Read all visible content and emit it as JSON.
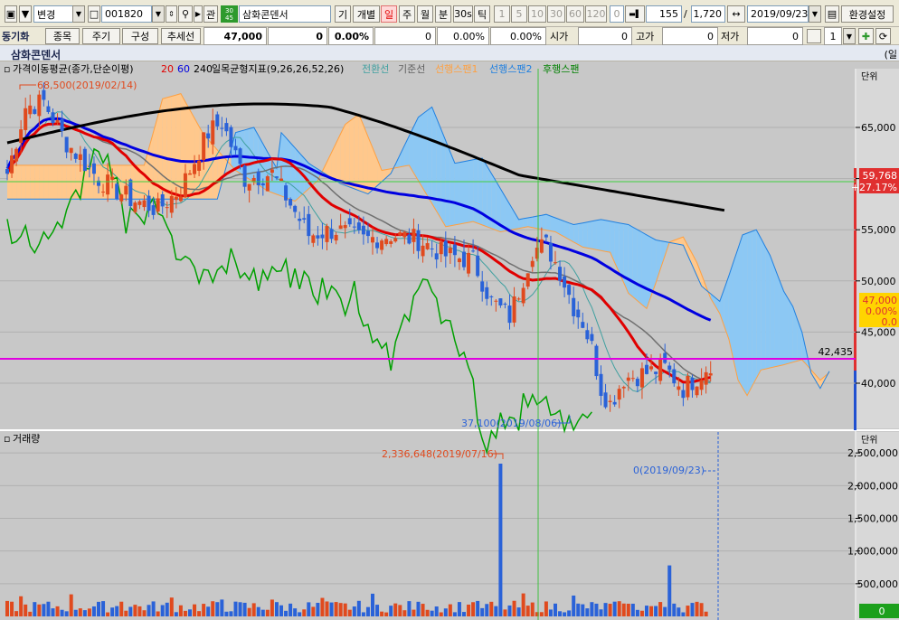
{
  "toolbar": {
    "mode_label": "변경",
    "code_value": "001820",
    "gwan_label": "관",
    "badge_label": "30\n45",
    "stock_name": "삼화콘덴서",
    "gi_label": "기",
    "gaebyeol_label": "개별",
    "periods": [
      "일",
      "주",
      "월",
      "분",
      "30s",
      "틱"
    ],
    "period_nums": [
      "1",
      "5",
      "10",
      "30",
      "60",
      "120"
    ],
    "zero_value": "0",
    "count_value": "155",
    "total_value": "1,720",
    "date_value": "2019/09/23",
    "settings_label": "환경설정"
  },
  "toolbar2": {
    "sync_label": "동기화",
    "buttons": [
      "종목",
      "주기",
      "구성",
      "추세선"
    ],
    "price": "47,000",
    "change": "0",
    "change_pct": "0.00%",
    "v1": "0",
    "v1_pct": "0.00%",
    "v2_pct": "0.00%",
    "open_label": "시가",
    "open_value": "0",
    "high_label": "고가",
    "high_value": "0",
    "low_label": "저가",
    "low_value": "0",
    "spin_value": "1"
  },
  "title": {
    "stock_name": "삼화콘덴서",
    "right_label": "(일"
  },
  "legend": {
    "ma_label": "가격이동평균(종가,단순이평)",
    "ma20": "20",
    "ma60": "60",
    "ma240": "240",
    "ichimoku_label": "일목균형지표(9,26,26,52,26)",
    "conversion": "전환선",
    "base": "기준선",
    "span1": "선행스팬1",
    "span2": "선행스팬2",
    "lagging": "후행스팬"
  },
  "annotations": {
    "high": "68,500(2019/02/14)",
    "low": "37,100(2019/08/06)",
    "hline_value": "42,435",
    "vol_max": "2,336,648(2019/07/16)",
    "vol_last": "0(2019/09/23)"
  },
  "axis": {
    "price_ticks": [
      "65,000",
      "60,000",
      "55,000",
      "50,000",
      "45,000",
      "40,000"
    ],
    "price_tick_values": [
      65000,
      60000,
      55000,
      50000,
      45000,
      40000
    ],
    "volume_ticks": [
      "2,500,000",
      "2,000,000",
      "1,500,000",
      "1,000,000",
      "500,000"
    ],
    "volume_tick_values": [
      2500000,
      2000000,
      1500000,
      1000000,
      500000
    ],
    "unit_label": "단위",
    "unit_label_vol": "단위"
  },
  "price_box": {
    "ma_value": "59,768",
    "ma_pct": "+27.17%",
    "last_value": "47,000",
    "last_pct": "0.00%",
    "last_change": "0.0"
  },
  "volume": {
    "label": "거래량",
    "last_box": "0"
  },
  "colors": {
    "up": "#e04a1e",
    "down": "#2a62d8",
    "ma20": "#e00000",
    "ma60": "#0000e0",
    "ma240": "#000000",
    "cloud_bull": "#ffc88c",
    "cloud_bear": "#8cc8f4",
    "lagging": "#00a000",
    "hline": "#e000e0"
  }
}
